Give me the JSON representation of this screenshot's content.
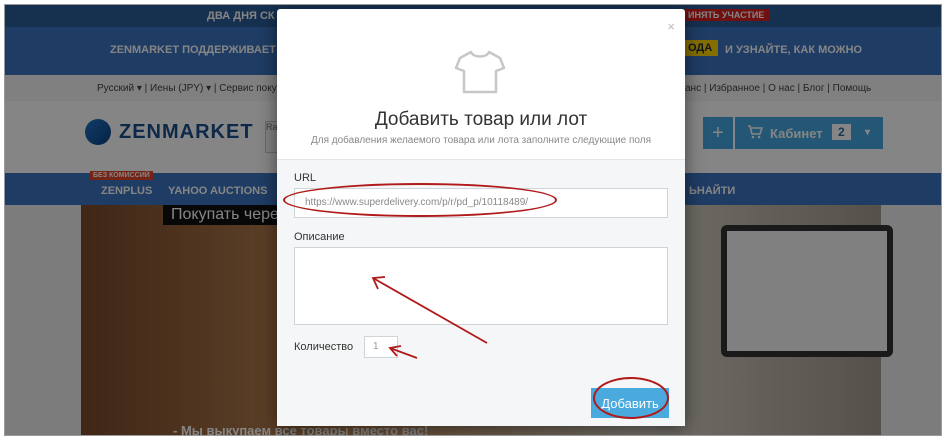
{
  "promo": {
    "text": "ДВА ДНЯ СК",
    "join": "ИНЯТЬ УЧАСТИЕ"
  },
  "support": {
    "left": "ZENMARKET ПОДДЕРЖИВАЕТ У",
    "code": "ОДА",
    "right": "И УЗНАЙТЕ, КАК МОЖНО"
  },
  "util": {
    "left": "Русский ▾  |  Иены (JPY) ▾  |  Сервис поку",
    "right": "анс  |  Избранное  |  О нас  |  Блог  |  Помощь"
  },
  "header": {
    "logo": "ZENMARKET",
    "search_hint": "Ra",
    "plus": "+",
    "cabinet": "Кабинет",
    "cabinet_count": "2",
    "cart_icon": "cart-icon",
    "chevron": "▾"
  },
  "nav": {
    "badge": "БЕЗ КОМИССИЙ",
    "item1": "ZENPLUS",
    "item2": "YAHOO AUCTIONS",
    "item3": "ЬНАЙТИ"
  },
  "hero": {
    "caption": "Покупать чере",
    "tagline": "- Мы выкупаем все товары вместо вас!"
  },
  "modal": {
    "close": "×",
    "icon": "tshirt-icon",
    "title": "Добавить товар или лот",
    "subtitle": "Для добавления желаемого товара или лота заполните следующие поля",
    "url_label": "URL",
    "url_value": "https://www.superdelivery.com/p/r/pd_p/10118489/",
    "desc_label": "Описание",
    "desc_value": "",
    "qty_label": "Количество",
    "qty_value": "1",
    "submit": "Добавить"
  },
  "colors": {
    "primary": "#3c74c0",
    "accent": "#4aa9dd",
    "annotation": "#b01a1a"
  }
}
